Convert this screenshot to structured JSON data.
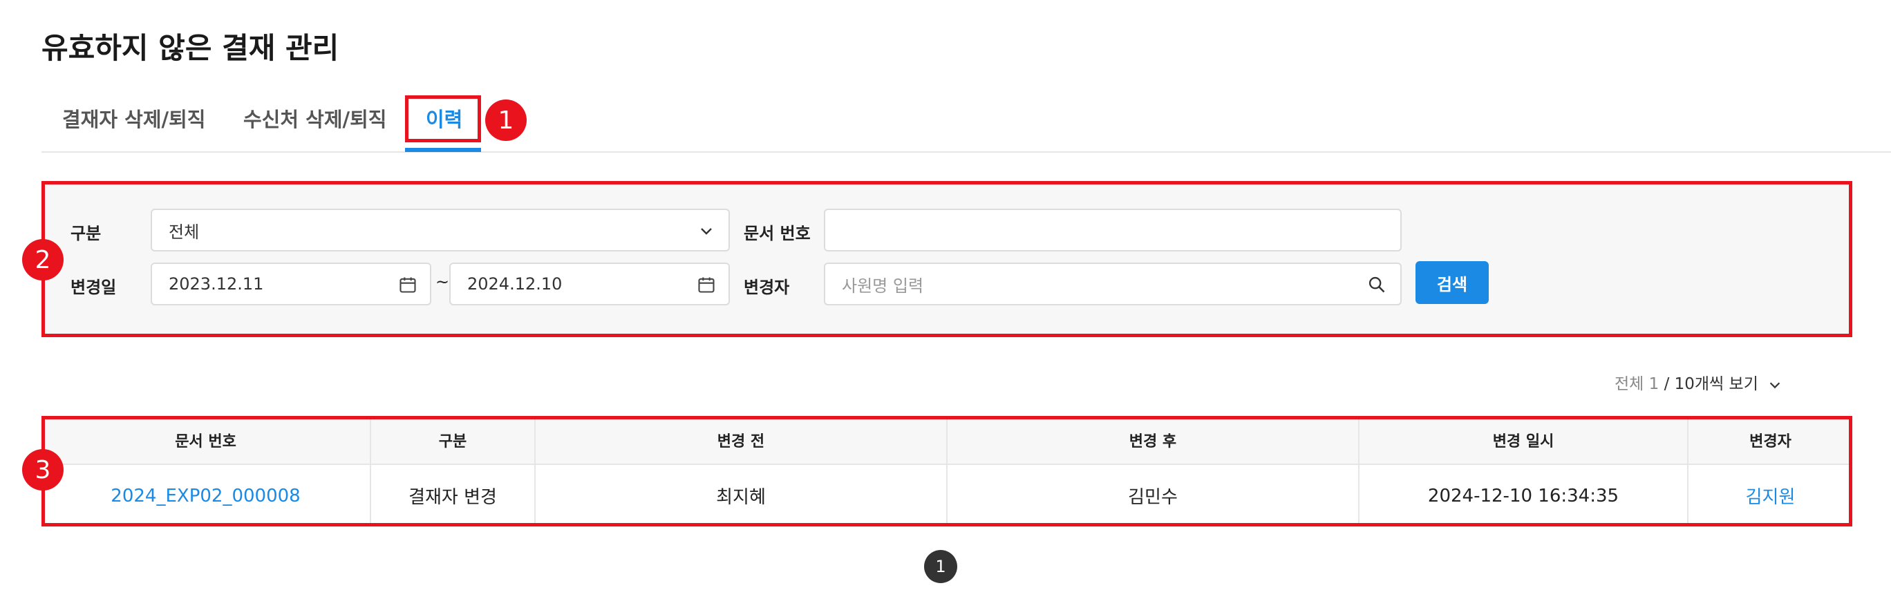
{
  "page": {
    "title": "유효하지 않은 결재 관리"
  },
  "tabs": [
    {
      "label": "결재자 삭제/퇴직"
    },
    {
      "label": "수신처 삭제/퇴직"
    },
    {
      "label": "이력"
    }
  ],
  "badges": [
    "1",
    "2",
    "3"
  ],
  "filter": {
    "category_label": "구분",
    "category_value": "전체",
    "doc_no_label": "문서 번호",
    "doc_no_value": "",
    "date_label": "변경일",
    "date_from": "2023.12.11",
    "date_sep": "~",
    "date_to": "2024.12.10",
    "changer_label": "변경자",
    "changer_placeholder": "사원명 입력",
    "search_label": "검색"
  },
  "summary": {
    "total_label": "전체",
    "total_count": "1",
    "sep": "/",
    "per_page": "10개씩 보기"
  },
  "table": {
    "headers": [
      "문서 번호",
      "구분",
      "변경 전",
      "변경 후",
      "변경 일시",
      "변경자"
    ],
    "rows": [
      [
        "2024_EXP02_000008",
        "결재자 변경",
        "최지혜",
        "김민수",
        "2024-12-10 16:34:35",
        "김지원"
      ]
    ]
  },
  "pagination": {
    "current": "1"
  },
  "colors": {
    "accent": "#1a8ae5",
    "annotation": "#e8131c"
  }
}
